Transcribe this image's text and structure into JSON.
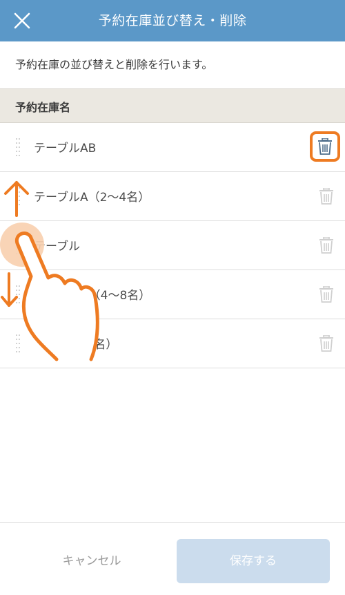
{
  "header": {
    "title": "予約在庫並び替え・削除",
    "close_icon": "close-icon",
    "background": "#5b98c8"
  },
  "description": "予約在庫の並び替えと削除を行います。",
  "section": {
    "title": "予約在庫名"
  },
  "items": [
    {
      "label": "テーブルAB"
    },
    {
      "label": "テーブルA（2〜4名）"
    },
    {
      "label": "テーブル"
    },
    {
      "label": "　　　　B（4〜8名）"
    },
    {
      "label": "　　　　（1名）"
    }
  ],
  "icons": {
    "drag_handle": "drag-handle-icon",
    "delete": "trash-icon",
    "gesture": "hand-swipe-icon"
  },
  "footer": {
    "cancel_label": "キャンセル",
    "save_label": "保存する"
  },
  "colors": {
    "accent": "#ee7b22",
    "header": "#5b98c8",
    "save_disabled": "#cbdced"
  }
}
